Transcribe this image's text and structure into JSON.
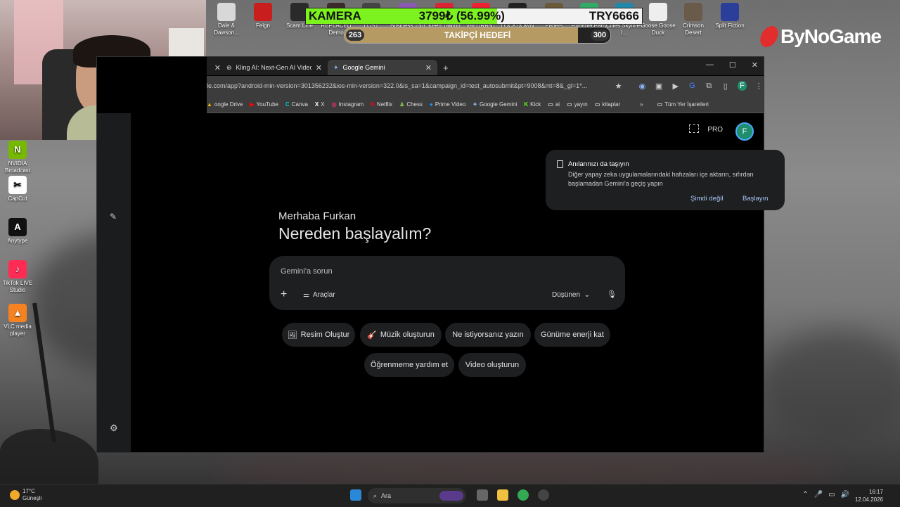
{
  "desktop": {
    "top_icons": [
      {
        "label": "Dale & Dawson...",
        "color": "#d8d8d8"
      },
      {
        "label": "Feign",
        "color": "#c81e1e"
      },
      {
        "label": "Scam Line",
        "color": "#2a2a2a"
      },
      {
        "label": "REPLACED Demo",
        "color": "#3a2a2a"
      },
      {
        "label": "LOST",
        "color": "#444"
      },
      {
        "label": "Business Tour",
        "color": "#8a5ab3"
      },
      {
        "label": "Keep Talking",
        "color": "#d23"
      },
      {
        "label": "VALORANT",
        "color": "#e23"
      },
      {
        "label": "LOCKDOWN",
        "color": "#222"
      },
      {
        "label": "Papers",
        "color": "#6a5a3a"
      },
      {
        "label": "Rummel Party",
        "color": "#3a6"
      },
      {
        "label": "Cities Skylines I...",
        "color": "#28a"
      },
      {
        "label": "Goose Goose Duck",
        "color": "#eee"
      },
      {
        "label": "Crimson Desert",
        "color": "#6a5a4a"
      },
      {
        "label": "Split Fiction",
        "color": "#2b3f9a"
      }
    ],
    "left_icons": [
      {
        "label": "NVIDIA Broadcast",
        "color": "#76b900",
        "glyph": "N"
      },
      {
        "label": "CapCut",
        "color": "#fff",
        "glyph": "✂"
      },
      {
        "label": "Anytype",
        "color": "#111",
        "glyph": "A"
      },
      {
        "label": "TikTok LIVE Studio",
        "color": "#fe2c55",
        "glyph": "♪"
      },
      {
        "label": "VLC media player",
        "color": "#f58220",
        "glyph": "▲"
      }
    ]
  },
  "overlay": {
    "camera_label": "KAMERA",
    "camera_value": "3799₺ (56.99%)",
    "camera_progress": 0.5699,
    "camera_target": "TRY6666",
    "goal_start": "263",
    "goal_label": "TAKİPÇİ HEDEFİ",
    "goal_end": "300",
    "goal_progress": 0.877,
    "logo_text": "ByNoGame"
  },
  "browser": {
    "tabs": [
      {
        "label": "Kling AI: Next-Gen AI Video & A",
        "active": false
      },
      {
        "label": "Google Gemini",
        "active": true
      }
    ],
    "new_tab": "+",
    "url": "le.com/app?android-min-version=301356232&ios-min-version=322.0&is_sa=1&campaign_id=test_autosubmit&pt=9008&mt=8&_gl=1*...",
    "bookmarks": [
      {
        "label": "oogle Drive",
        "icon": "▲",
        "color": "#f4b400"
      },
      {
        "label": "YouTube",
        "icon": "▶",
        "color": "#ff0000"
      },
      {
        "label": "Canva",
        "icon": "C",
        "color": "#00c4cc"
      },
      {
        "label": "X",
        "icon": "X",
        "color": "#fff"
      },
      {
        "label": "Instagram",
        "icon": "◎",
        "color": "#e1306c"
      },
      {
        "label": "Netflix",
        "icon": "N",
        "color": "#e50914"
      },
      {
        "label": "Chess",
        "icon": "♟",
        "color": "#81b64c"
      },
      {
        "label": "Prime Video",
        "icon": "●",
        "color": "#1a98ff"
      },
      {
        "label": "Google Gemini",
        "icon": "✦",
        "color": "#8ab4f8"
      },
      {
        "label": "Kick",
        "icon": "K",
        "color": "#53fc18"
      },
      {
        "label": "ai",
        "icon": "▭",
        "color": "#ccc"
      },
      {
        "label": "yayın",
        "icon": "▭",
        "color": "#ccc"
      },
      {
        "label": "kitaplar",
        "icon": "▭",
        "color": "#ccc"
      }
    ],
    "bookmarks_more": "»",
    "all_bookmarks": "Tüm Yer İşaretleri"
  },
  "gemini": {
    "pro_label": "PRO",
    "avatar_letter": "F",
    "card": {
      "title": "Anılarınızı da taşıyın",
      "desc": "Diğer yapay zeka uygulamalarındaki hafızaları içe aktarın, sıfırdan başlamadan Gemini'a geçiş yapın",
      "later": "Şimdi değil",
      "start": "Başlayın"
    },
    "greeting": "Merhaba Furkan",
    "headline": "Nereden başlayalım?",
    "prompt_placeholder": "Gemini'a sorun",
    "tools_label": "Araçlar",
    "mode_label": "Düşünen",
    "chips": [
      {
        "label": "Resim Oluştur",
        "emoji": "🖼"
      },
      {
        "label": "Müzik oluşturun",
        "emoji": "🎸"
      },
      {
        "label": "Ne istiyorsanız yazın",
        "emoji": ""
      },
      {
        "label": "Günüme enerji kat",
        "emoji": ""
      },
      {
        "label": "Öğrenmeme yardım et",
        "emoji": ""
      },
      {
        "label": "Video oluşturun",
        "emoji": ""
      }
    ]
  },
  "taskbar": {
    "temp": "17°C",
    "weather": "Güneşli",
    "search": "Ara",
    "time": "16:17",
    "date": "12.04.2026"
  }
}
